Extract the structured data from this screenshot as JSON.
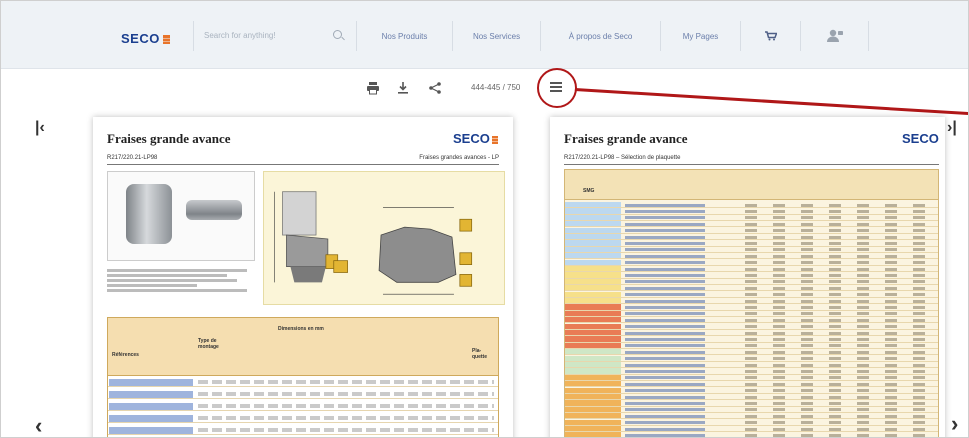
{
  "nav": {
    "logo": "SECO",
    "search_placeholder": "Search for anything!",
    "links": [
      "Nos Produits",
      "Nos Services",
      "À propos de Seco",
      "My Pages"
    ]
  },
  "toolbar": {
    "page_indicator": "444-445 / 750"
  },
  "left_page": {
    "title": "Fraises grande avance",
    "logo": "SECO",
    "code": "R217/220.21-LP98",
    "category": "Fraises grandes avances - LP",
    "table_header_group": "Dimensions en mm",
    "col_references": "Références",
    "col_type": "Type de montage",
    "col_plaquette": "Pla- quette"
  },
  "right_page": {
    "title": "Fraises grande avance",
    "logo": "SECO",
    "code": "R217/220.21-LP98 – Sélection de plaquette",
    "col_smg": "SMG"
  },
  "colors": {
    "accent_red": "#b01718",
    "brand_blue": "#1b3f8f",
    "brand_orange": "#e8742a"
  }
}
